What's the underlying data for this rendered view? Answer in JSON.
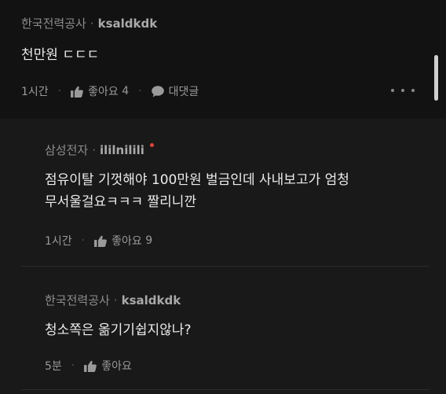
{
  "comment": {
    "company": "한국전력공사",
    "username": "ksaldkdk",
    "text": "천만원 ㄷㄷㄷ",
    "time": "1시간",
    "like_label": "좋아요",
    "like_count": "4",
    "reply_label": "대댓글"
  },
  "replies": [
    {
      "company": "삼성전자",
      "username": "ililnilili",
      "text_lines": [
        "점유이탈 기껏해야 100만원 벌금인데 사내보고가 엄청",
        "무서울걸요ㅋㅋㅋ 짤리니깐"
      ],
      "time": "1시간",
      "like_label": "좋아요",
      "like_count": "9"
    },
    {
      "company": "한국전력공사",
      "username": "ksaldkdk",
      "text_lines": [
        "청소쪽은 옮기기쉽지않나?"
      ],
      "time": "5분",
      "like_label": "좋아요",
      "like_count": ""
    }
  ],
  "separator": "·",
  "icons": {
    "like": "thumbs-up-icon",
    "reply": "speech-bubble-icon",
    "more": "more-horizontal-icon",
    "new_badge": "red-dot-badge"
  },
  "colors": {
    "background": "#121212",
    "reply_background": "#191919",
    "new_badge": "#e0433b"
  }
}
